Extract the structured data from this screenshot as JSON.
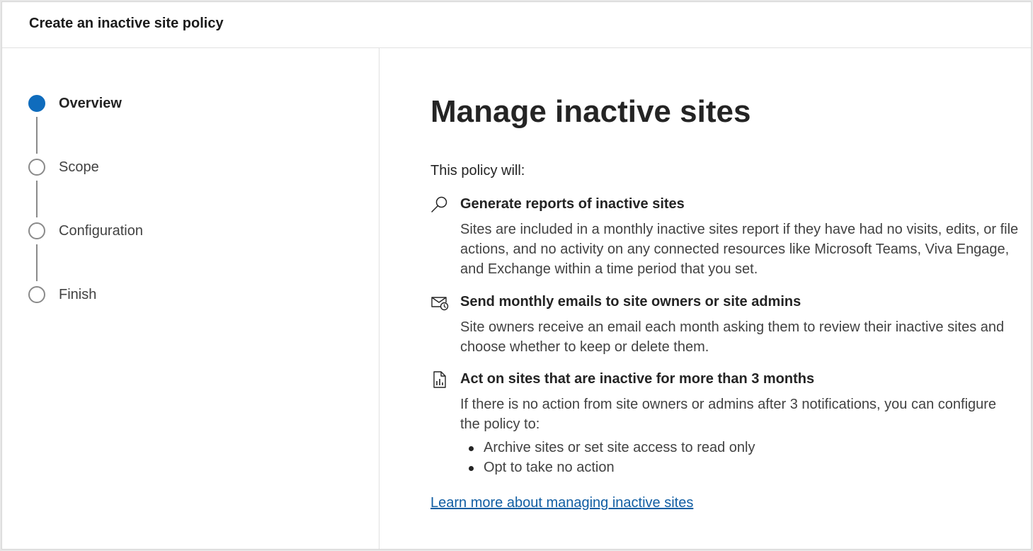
{
  "header": {
    "title": "Create an inactive site policy"
  },
  "steps": [
    {
      "label": "Overview",
      "state": "active"
    },
    {
      "label": "Scope",
      "state": "pending"
    },
    {
      "label": "Configuration",
      "state": "pending"
    },
    {
      "label": "Finish",
      "state": "pending"
    }
  ],
  "main": {
    "title": "Manage inactive sites",
    "intro": "This policy will:",
    "features": [
      {
        "icon": "search-icon",
        "title": "Generate reports of inactive sites",
        "description": "Sites are included in a monthly inactive sites report if they have had no visits, edits, or file actions, and no activity on any connected resources like Microsoft Teams, Viva Engage, and Exchange within a time period that you set."
      },
      {
        "icon": "mail-clock-icon",
        "title": "Send monthly emails to site owners or site admins",
        "description": "Site owners receive an email each month asking them to review their inactive sites and choose whether to keep or delete them."
      },
      {
        "icon": "document-chart-icon",
        "title": "Act on sites that are inactive for more than 3 months",
        "description": "If there is no action from site owners or admins after 3 notifications, you can configure the policy to:",
        "bullets": [
          "Archive sites or set site access to read only",
          "Opt to take no action"
        ]
      }
    ],
    "learn_more": "Learn more about managing inactive sites"
  },
  "colors": {
    "accent": "#0f6cbd",
    "link": "#115ea3",
    "step_line": "#8a8a8a"
  }
}
